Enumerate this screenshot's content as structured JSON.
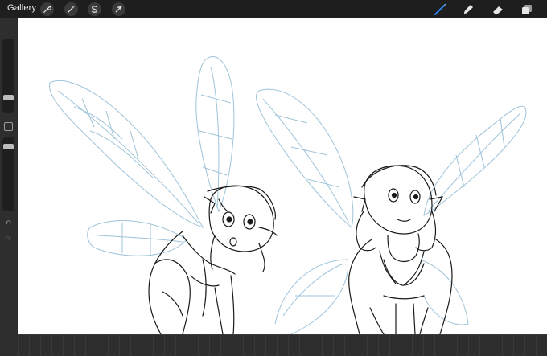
{
  "app": {
    "gallery_label": "Gallery"
  },
  "toolbar": {
    "left_tools": [
      {
        "name": "actions",
        "icon": "wrench-icon"
      },
      {
        "name": "adjustments",
        "icon": "magic-wand-icon"
      },
      {
        "name": "selection",
        "icon": "selection-s-icon"
      },
      {
        "name": "transform",
        "icon": "arrow-cursor-icon"
      }
    ],
    "right_tools": [
      {
        "name": "brush",
        "icon": "brush-icon",
        "active": true
      },
      {
        "name": "smudge",
        "icon": "smudge-icon",
        "active": false
      },
      {
        "name": "eraser",
        "icon": "eraser-icon",
        "active": false
      },
      {
        "name": "layers",
        "icon": "layers-icon",
        "active": false
      }
    ]
  },
  "sidebar": {
    "brush_size": 0.4,
    "brush_opacity": 1.0,
    "undo_icon": "undo-icon",
    "redo_icon": "redo-icon"
  },
  "colors": {
    "accent_blue": "#2f7de1",
    "toolbar_bg": "#1e1e1e",
    "canvas_bg": "#ffffff",
    "sketch_line": "#1a1a1a",
    "wing_line": "#9fc3d9"
  }
}
